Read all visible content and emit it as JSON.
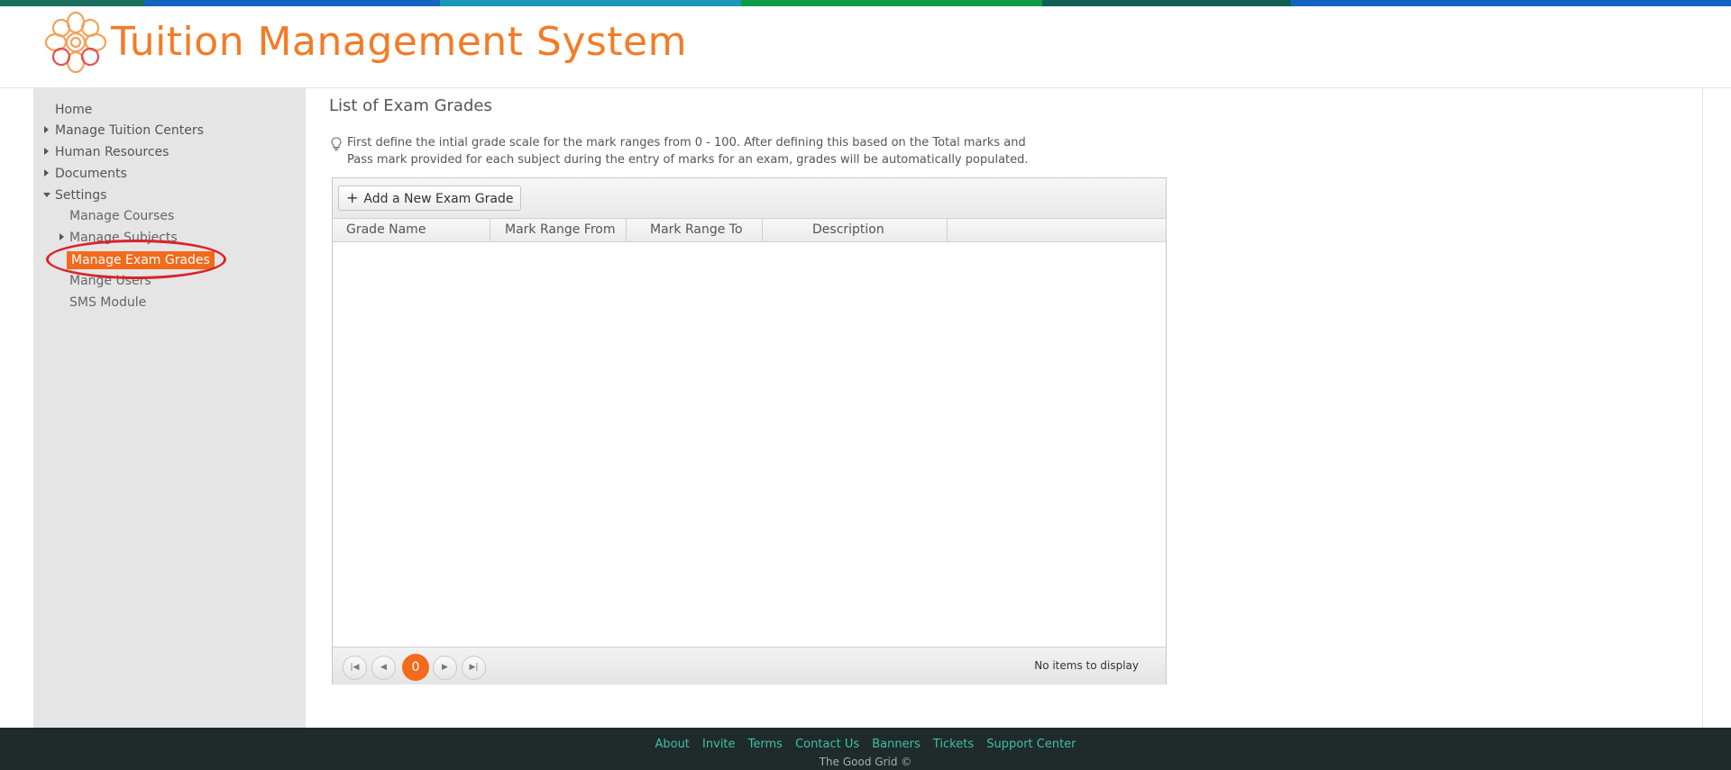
{
  "app": {
    "title": "Tuition Management System"
  },
  "colors": {
    "accent": "#f47b25",
    "active_bg": "#f26a1b",
    "annotation": "#d9232a",
    "footer_bg": "#1f2a2a",
    "footer_link": "#3fc1a5",
    "topbar_stripes": [
      "#1a6e5e",
      "#1565c0",
      "#1a96b8",
      "#0f9a48",
      "#115e55",
      "#1565c0"
    ]
  },
  "sidebar": {
    "items": [
      {
        "label": "Home",
        "icon": "none"
      },
      {
        "label": "Manage Tuition Centers",
        "icon": "caret-right-icon"
      },
      {
        "label": "Human Resources",
        "icon": "caret-right-icon"
      },
      {
        "label": "Documents",
        "icon": "caret-right-icon"
      },
      {
        "label": "Settings",
        "icon": "caret-down-icon"
      }
    ],
    "settings_children": [
      {
        "label": "Manage Courses",
        "icon": "none"
      },
      {
        "label": "Manage Subjects",
        "icon": "caret-right-icon"
      },
      {
        "label": "Manage Exam Grades",
        "icon": "none",
        "selected": true
      },
      {
        "label": "Mange Users",
        "icon": "none"
      },
      {
        "label": "SMS Module",
        "icon": "none"
      }
    ]
  },
  "main": {
    "title": "List of Exam Grades",
    "hint": "First define the intial grade scale for the mark ranges from 0 - 100. After defining this based on the Total marks and Pass mark provided for each subject during the entry of marks for an exam, grades will be automatically populated.",
    "hint_icon": "lightbulb-icon",
    "toolbar": {
      "add_label": "Add a New Exam Grade",
      "add_icon": "plus-icon"
    },
    "grid": {
      "columns": [
        "Grade Name",
        "Mark Range From",
        "Mark Range To",
        "Description"
      ],
      "rows": []
    },
    "pager": {
      "current_page": "0",
      "info": "No items to display",
      "buttons": [
        "first-page-icon",
        "prev-page-icon",
        "next-page-icon",
        "last-page-icon"
      ]
    }
  },
  "footer": {
    "links": [
      "About",
      "Invite",
      "Terms",
      "Contact Us",
      "Banners",
      "Tickets",
      "Support Center"
    ],
    "copyright": "The Good Grid ©"
  }
}
